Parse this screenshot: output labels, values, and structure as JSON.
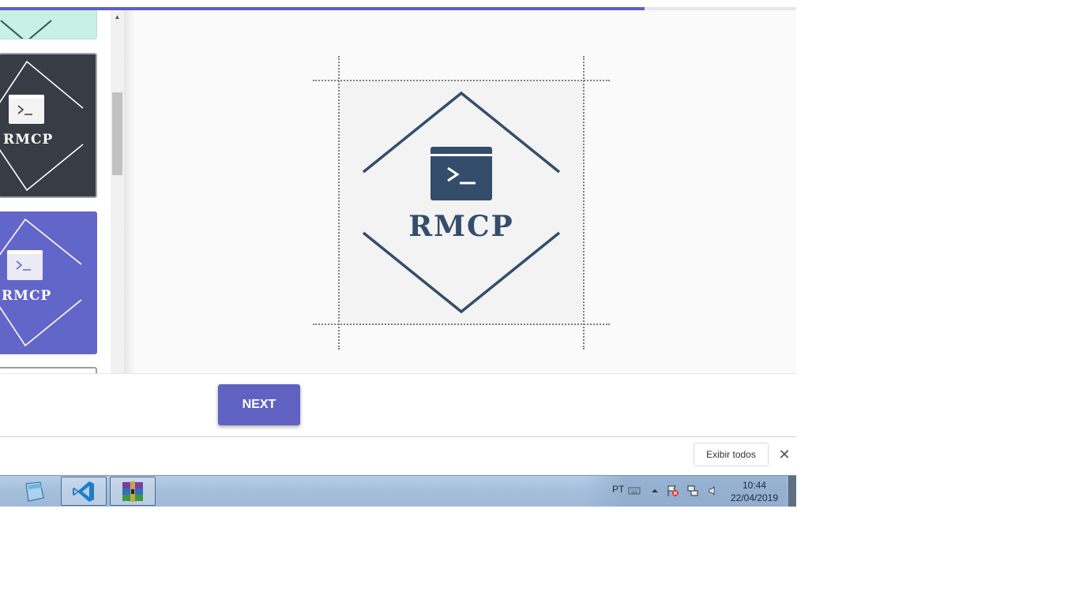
{
  "progress": {
    "fraction": 0.81
  },
  "thumbnails": [
    {
      "name": "theme-mint",
      "label": ""
    },
    {
      "name": "theme-dark",
      "label": "RMCP"
    },
    {
      "name": "theme-purple",
      "label": "RMCP"
    }
  ],
  "preview": {
    "logo_text": "RMCP",
    "logo_color": "#344d6b",
    "canvas_bg": "#f3f3f3"
  },
  "footer": {
    "next_label": "NEXT"
  },
  "download_bar": {
    "show_all_label": "Exibir todos",
    "close_symbol": "✕"
  },
  "taskbar": {
    "apps": [
      "notepad-icon",
      "vscode-icon",
      "winrar-icon"
    ],
    "language": "PT",
    "time": "10:44",
    "date": "22/04/2019"
  },
  "colors": {
    "accent": "#5f62c0",
    "dark_theme": "#373c45",
    "mint_theme": "#c8f0e5"
  }
}
